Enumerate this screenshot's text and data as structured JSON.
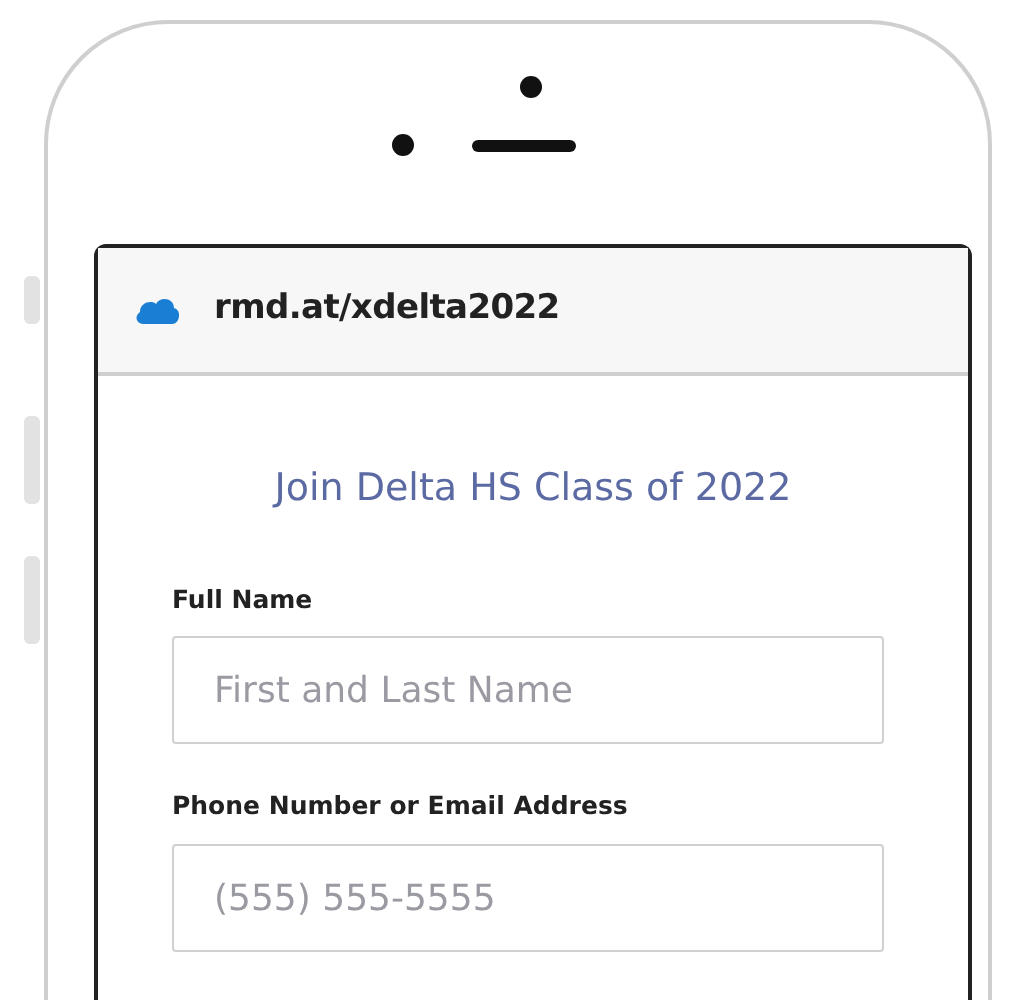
{
  "address_bar": {
    "url": "rmd.at/xdelta2022"
  },
  "form": {
    "title": "Join Delta HS Class of 2022",
    "fields": [
      {
        "label": "Full Name",
        "placeholder": "First and Last Name"
      },
      {
        "label": "Phone Number or Email Address",
        "placeholder": "(555) 555-5555"
      }
    ]
  }
}
